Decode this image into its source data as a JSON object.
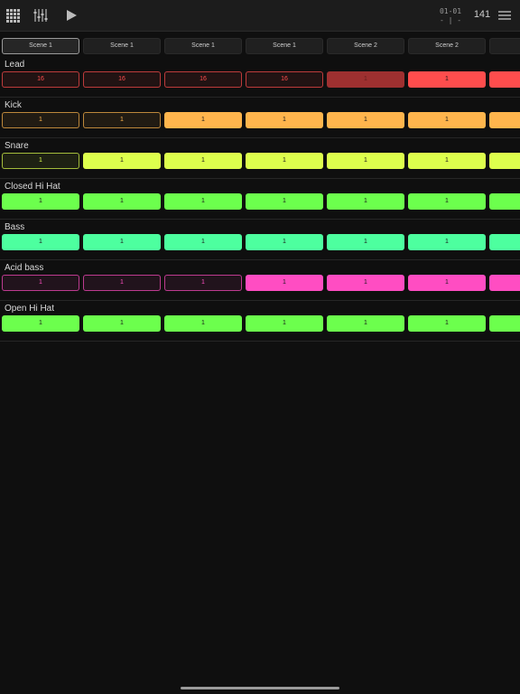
{
  "toolbar": {
    "position_top": "01-01",
    "position_bottom": "- | -",
    "tempo": "141"
  },
  "scenes": [
    {
      "label": "Scene 1",
      "active": true
    },
    {
      "label": "Scene 1",
      "active": false
    },
    {
      "label": "Scene 1",
      "active": false
    },
    {
      "label": "Scene 1",
      "active": false
    },
    {
      "label": "Scene 2",
      "active": false
    },
    {
      "label": "Scene 2",
      "active": false
    },
    {
      "label": "S",
      "active": false
    }
  ],
  "tracks": [
    {
      "name": "Lead",
      "color": "#ff4d4d",
      "clips": [
        {
          "label": "16",
          "state": "outline"
        },
        {
          "label": "16",
          "state": "outline"
        },
        {
          "label": "16",
          "state": "outline"
        },
        {
          "label": "16",
          "state": "outline"
        },
        {
          "label": "1",
          "state": "dim"
        },
        {
          "label": "1",
          "state": "filled"
        },
        {
          "label": "",
          "state": "filled"
        }
      ]
    },
    {
      "name": "Kick",
      "color": "#ffb54d",
      "clips": [
        {
          "label": "1",
          "state": "outline"
        },
        {
          "label": "1",
          "state": "outline"
        },
        {
          "label": "1",
          "state": "filled"
        },
        {
          "label": "1",
          "state": "filled"
        },
        {
          "label": "1",
          "state": "filled"
        },
        {
          "label": "1",
          "state": "filled"
        },
        {
          "label": "",
          "state": "filled"
        }
      ]
    },
    {
      "name": "Snare",
      "color": "#ddff4d",
      "clips": [
        {
          "label": "1",
          "state": "outline"
        },
        {
          "label": "1",
          "state": "filled"
        },
        {
          "label": "1",
          "state": "filled"
        },
        {
          "label": "1",
          "state": "filled"
        },
        {
          "label": "1",
          "state": "filled"
        },
        {
          "label": "1",
          "state": "filled"
        },
        {
          "label": "",
          "state": "filled"
        }
      ]
    },
    {
      "name": "Closed Hi Hat",
      "color": "#6cff4d",
      "clips": [
        {
          "label": "1",
          "state": "filled"
        },
        {
          "label": "1",
          "state": "filled"
        },
        {
          "label": "1",
          "state": "filled"
        },
        {
          "label": "1",
          "state": "filled"
        },
        {
          "label": "1",
          "state": "filled"
        },
        {
          "label": "1",
          "state": "filled"
        },
        {
          "label": "",
          "state": "filled"
        }
      ]
    },
    {
      "name": "Bass",
      "color": "#4dff9f",
      "clips": [
        {
          "label": "1",
          "state": "filled"
        },
        {
          "label": "1",
          "state": "filled"
        },
        {
          "label": "1",
          "state": "filled"
        },
        {
          "label": "1",
          "state": "filled"
        },
        {
          "label": "1",
          "state": "filled"
        },
        {
          "label": "1",
          "state": "filled"
        },
        {
          "label": "",
          "state": "filled"
        }
      ]
    },
    {
      "name": "Acid bass",
      "color": "#ff4dc2",
      "clips": [
        {
          "label": "1",
          "state": "outline"
        },
        {
          "label": "1",
          "state": "outline"
        },
        {
          "label": "1",
          "state": "outline"
        },
        {
          "label": "1",
          "state": "filled"
        },
        {
          "label": "1",
          "state": "filled"
        },
        {
          "label": "1",
          "state": "filled"
        },
        {
          "label": "",
          "state": "filled"
        }
      ]
    },
    {
      "name": "Open Hi Hat",
      "color": "#6cff4d",
      "clips": [
        {
          "label": "1",
          "state": "filled"
        },
        {
          "label": "1",
          "state": "filled"
        },
        {
          "label": "1",
          "state": "filled"
        },
        {
          "label": "1",
          "state": "filled"
        },
        {
          "label": "1",
          "state": "filled"
        },
        {
          "label": "1",
          "state": "filled"
        },
        {
          "label": "",
          "state": "filled"
        }
      ]
    }
  ]
}
